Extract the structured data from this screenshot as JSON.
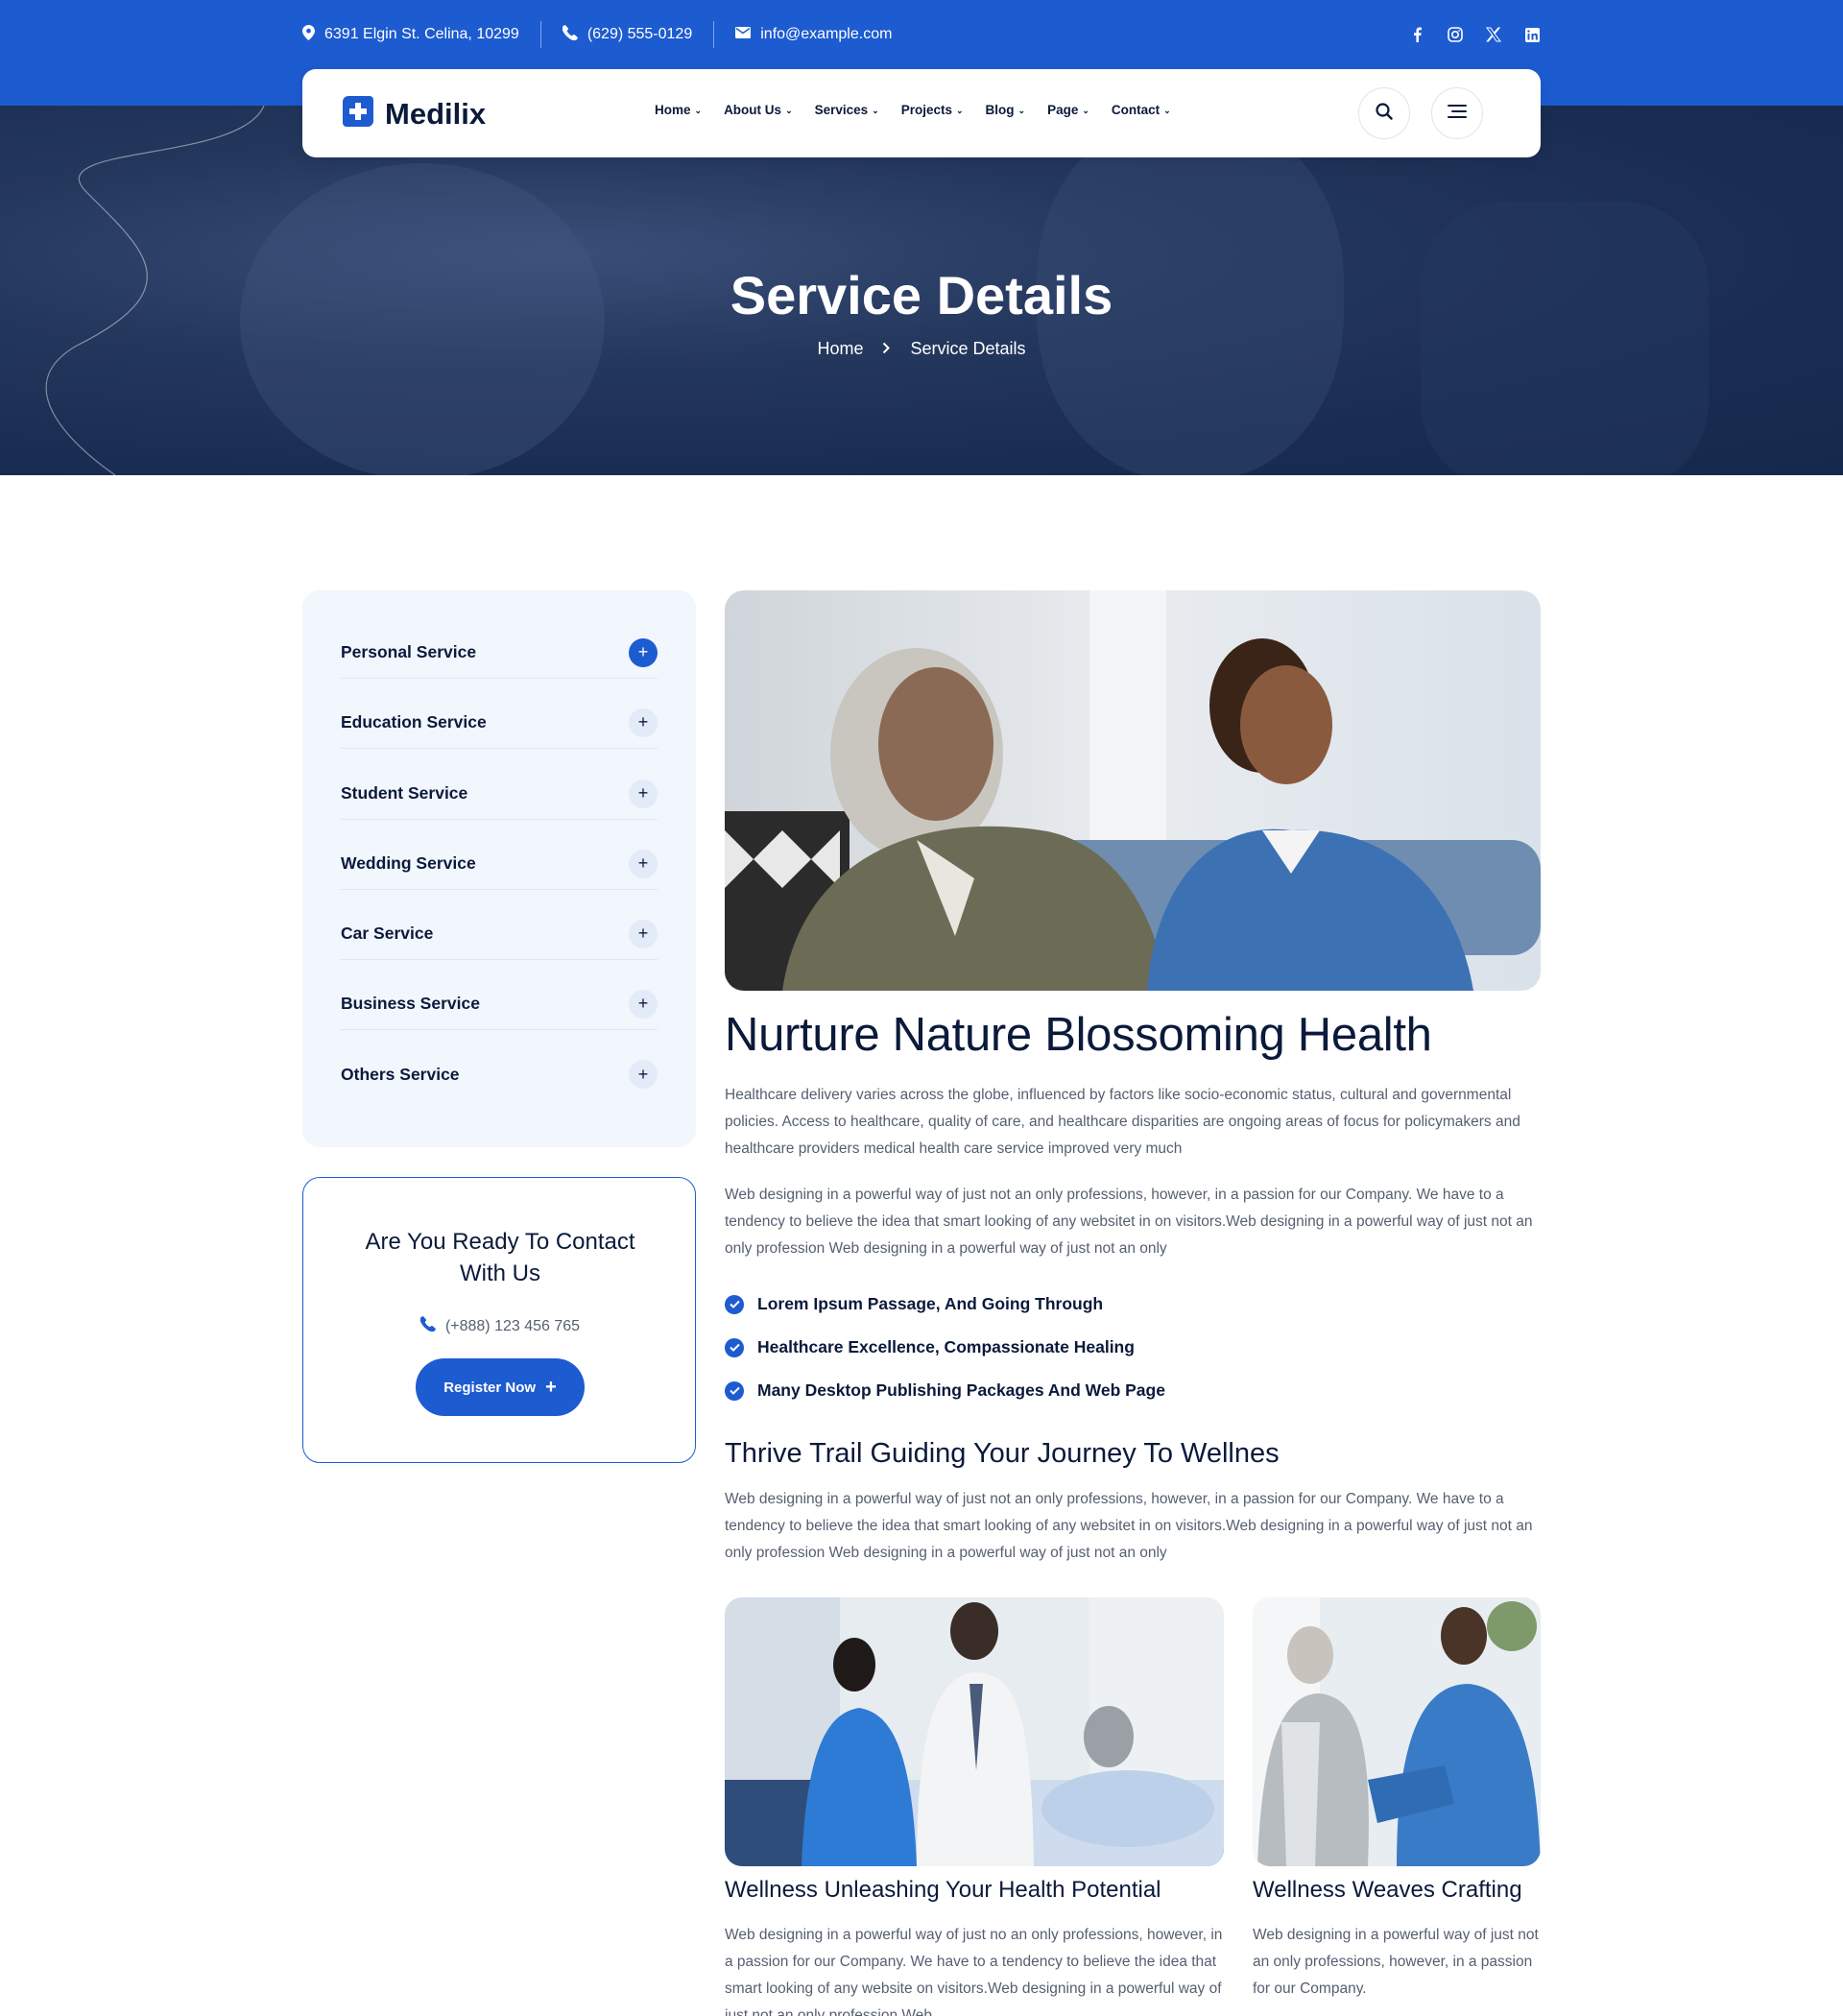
{
  "topbar": {
    "address": "6391 Elgin St. Celina, 10299",
    "phone": "(629) 555-0129",
    "email": "info@example.com",
    "social": [
      "facebook-icon",
      "instagram-icon",
      "x-twitter-icon",
      "linkedin-icon"
    ]
  },
  "brand": {
    "name": "Medilix",
    "accent": "#1d5bd0",
    "dark": "#0b1a3b"
  },
  "nav": {
    "items": [
      {
        "label": "Home"
      },
      {
        "label": "About Us"
      },
      {
        "label": "Services"
      },
      {
        "label": "Projects"
      },
      {
        "label": "Blog"
      },
      {
        "label": "Page"
      },
      {
        "label": "Contact"
      }
    ]
  },
  "hero": {
    "title": "Service Details",
    "breadcrumb": {
      "home": "Home",
      "current": "Service Details"
    }
  },
  "sidebar": {
    "services": [
      {
        "label": "Personal Service",
        "active": true
      },
      {
        "label": "Education Service"
      },
      {
        "label": "Student Service"
      },
      {
        "label": "Wedding Service"
      },
      {
        "label": "Car Service"
      },
      {
        "label": "Business Service"
      },
      {
        "label": "Others Service"
      }
    ],
    "contact": {
      "title": "Are You Ready To Contact With Us",
      "phone": "(+888) 123 456 765",
      "button": "Register Now"
    }
  },
  "main": {
    "title": "Nurture Nature Blossoming Health",
    "para1": "Healthcare delivery varies across the globe, influenced by factors like socio-economic status, cultural and governmental policies. Access to healthcare, quality of care, and healthcare disparities are ongoing areas of focus for policymakers and healthcare providers medical health care service improved very much",
    "para2": "Web designing in a powerful way of just not an only professions, however, in a passion for our Company. We have to a tendency to believe the idea that smart looking of any websitet in on visitors.Web designing in a powerful way of just not an only profession Web designing in a powerful way of just not an only",
    "checks": [
      "Lorem Ipsum Passage, And Going Through",
      "Healthcare Excellence, Compassionate Healing",
      "Many Desktop Publishing Packages And Web Page"
    ],
    "subtitle": "Thrive Trail Guiding Your Journey To Wellnes",
    "para3": "Web designing in a powerful way of just not an only professions, however, in a passion for our Company. We have to a tendency to believe the idea that smart looking of any websitet in on visitors.Web designing in a powerful way of just not an only profession Web designing in a powerful way of just not an only",
    "cards": [
      {
        "title": "Wellness Unleashing Your Health Potential",
        "text": "Web designing in a powerful way of just no an only professions, however, in a passion for our Company. We have to a tendency to believe the idea that smart looking of any website on visitors.Web designing in a powerful way of just not an only profession Web"
      },
      {
        "title": "Wellness Weaves Crafting",
        "text": "Web designing in a powerful way of just not an only professions, however, in a passion for our Company."
      }
    ]
  }
}
